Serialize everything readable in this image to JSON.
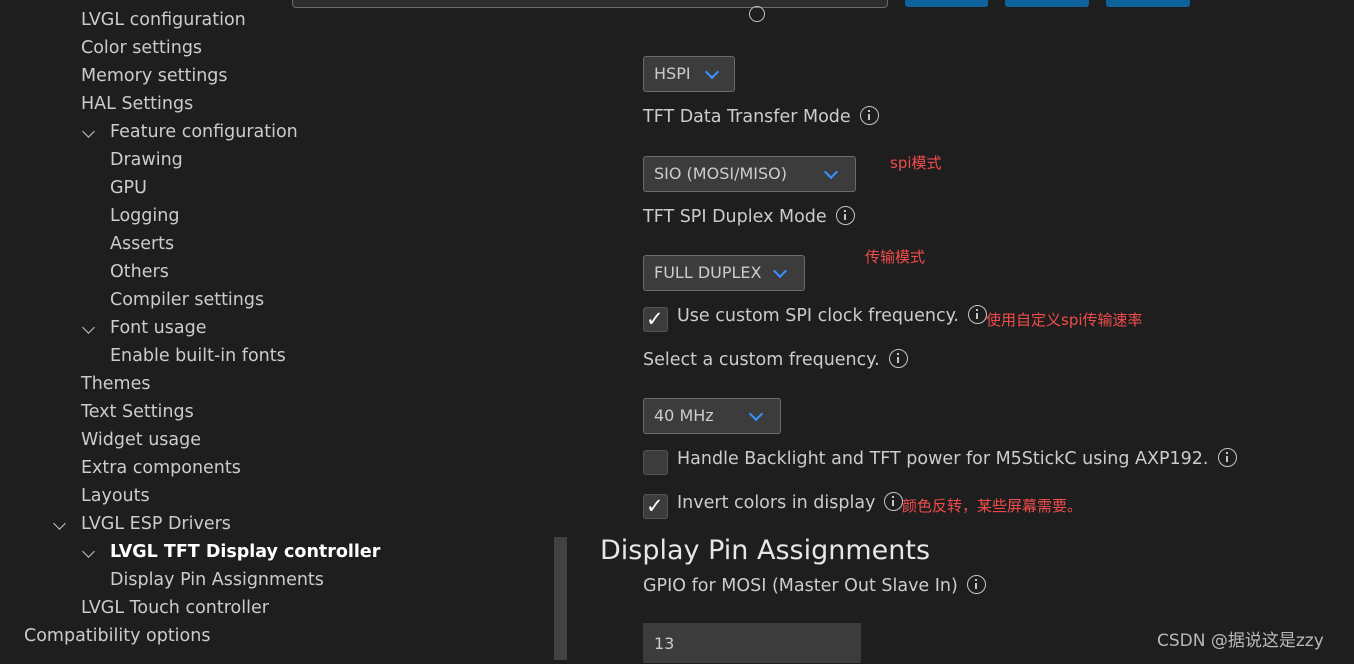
{
  "tree": {
    "items": [
      {
        "label": "LVGL configuration"
      },
      {
        "label": "Color settings"
      },
      {
        "label": "Memory settings"
      },
      {
        "label": "HAL Settings"
      },
      {
        "label": "Feature configuration"
      },
      {
        "label": "Drawing"
      },
      {
        "label": "GPU"
      },
      {
        "label": "Logging"
      },
      {
        "label": "Asserts"
      },
      {
        "label": "Others"
      },
      {
        "label": "Compiler settings"
      },
      {
        "label": "Font usage"
      },
      {
        "label": "Enable built-in fonts"
      },
      {
        "label": "Themes"
      },
      {
        "label": "Text Settings"
      },
      {
        "label": "Widget usage"
      },
      {
        "label": "Extra components"
      },
      {
        "label": "Layouts"
      },
      {
        "label": "LVGL ESP Drivers"
      },
      {
        "label": "LVGL TFT Display controller"
      },
      {
        "label": "Display Pin Assignments"
      },
      {
        "label": "LVGL Touch controller"
      },
      {
        "label": "Compatibility options"
      }
    ]
  },
  "settings": {
    "spi_bus_value": "HSPI",
    "transfer_mode_label": "TFT Data Transfer Mode",
    "transfer_mode_value": "SIO (MOSI/MISO)",
    "duplex_label": "TFT SPI Duplex Mode",
    "duplex_value": "FULL DUPLEX",
    "custom_clock_label": "Use custom SPI clock frequency.",
    "custom_clock_checked": true,
    "custom_freq_label": "Select a custom frequency.",
    "custom_freq_value": "40 MHz",
    "backlight_label": "Handle Backlight and TFT power for M5StickC using AXP192.",
    "backlight_checked": false,
    "invert_label": "Invert colors in display",
    "invert_checked": true
  },
  "annotations": {
    "spi_mode": "spi模式",
    "transfer_mode": "传输模式",
    "custom_rate": "使用自定义spi传输速率",
    "invert": "颜色反转，某些屏幕需要。"
  },
  "pins": {
    "section_title": "Display Pin Assignments",
    "mosi_label": "GPIO for MOSI (Master Out Slave In)",
    "mosi_value": "13"
  },
  "watermark": "CSDN @据说这是zzy",
  "colors": {
    "background": "#1e1e1e",
    "accent": "#3794ff",
    "annotation": "#f14c4c",
    "button": "#0e639c"
  }
}
